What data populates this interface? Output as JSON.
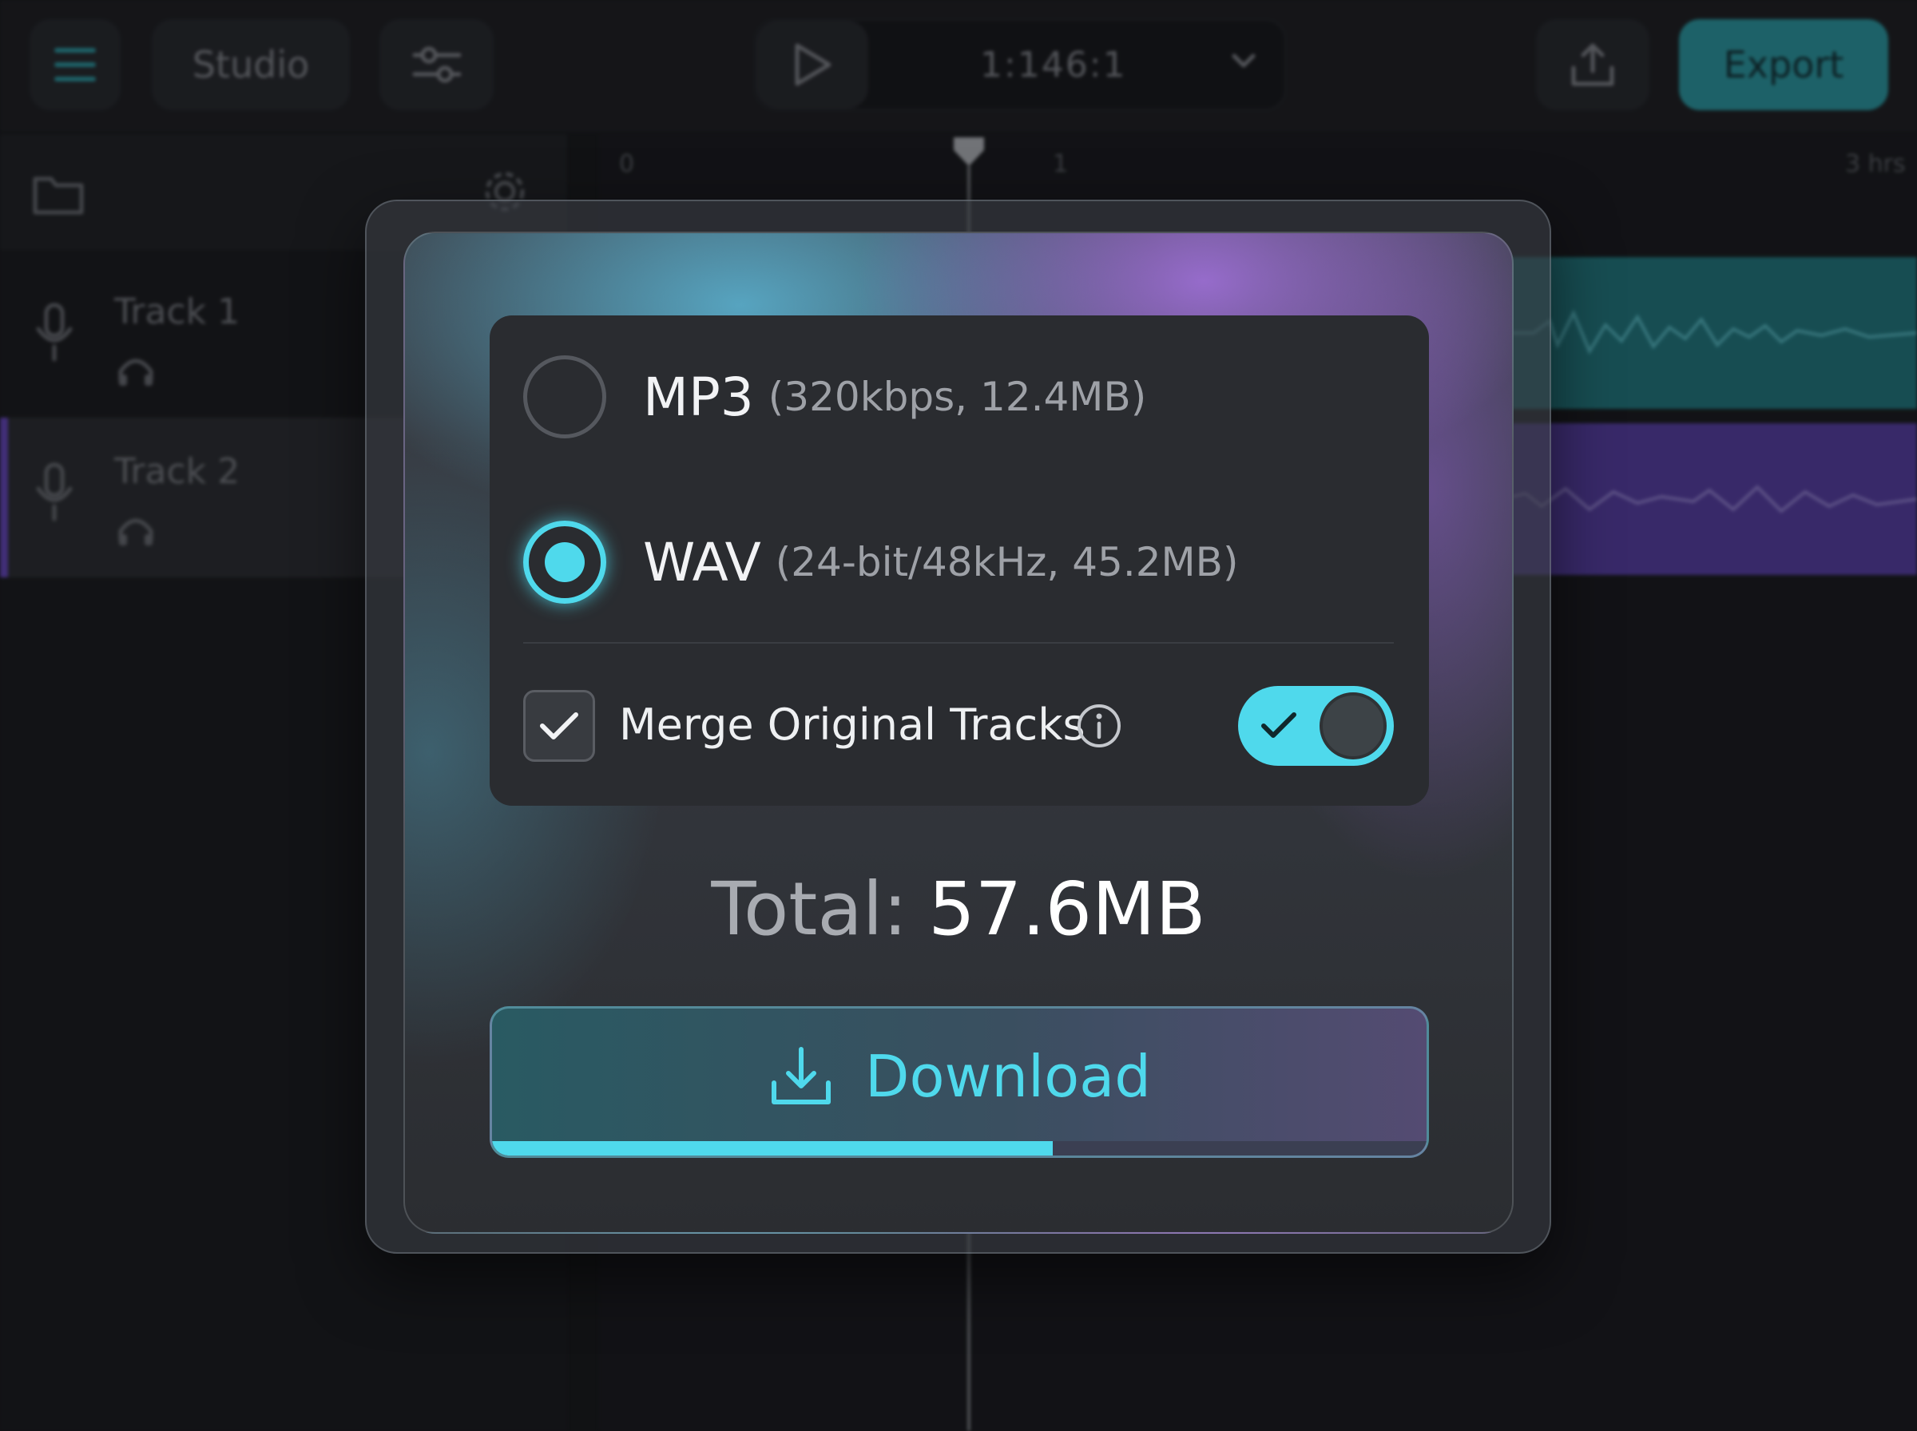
{
  "topbar": {
    "studio_label": "Studio",
    "timecode": "1:146:1",
    "export_label": "Export"
  },
  "timeline": {
    "ruler": [
      "0",
      "1",
      "3 hrs"
    ]
  },
  "tracks": [
    {
      "name": "Track 1"
    },
    {
      "name": "Track 2"
    }
  ],
  "export_dialog": {
    "formats": [
      {
        "name": "MP3",
        "detail": "(320kbps, 12.4MB)",
        "selected": false
      },
      {
        "name": "WAV",
        "detail": "(24-bit/48kHz, 45.2MB)",
        "selected": true
      }
    ],
    "merge": {
      "label": "Merge Original Tracks",
      "checked": true,
      "toggle_on": true
    },
    "total_label": "Total:",
    "total_value": "57.6MB",
    "download_label": "Download",
    "download_progress": 0.6
  },
  "colors": {
    "accent": "#4fd9ec",
    "export_button": "#2aa3ac",
    "track2_clip": "#5a3fae",
    "track1_clip": "#1f7f86"
  },
  "icons": [
    "menu-icon",
    "sliders-icon",
    "play-icon",
    "chevron-down-icon",
    "share-icon",
    "folder-icon",
    "gear-icon",
    "microphone-icon",
    "headphones-icon",
    "checkmark-icon",
    "info-icon",
    "download-icon"
  ]
}
